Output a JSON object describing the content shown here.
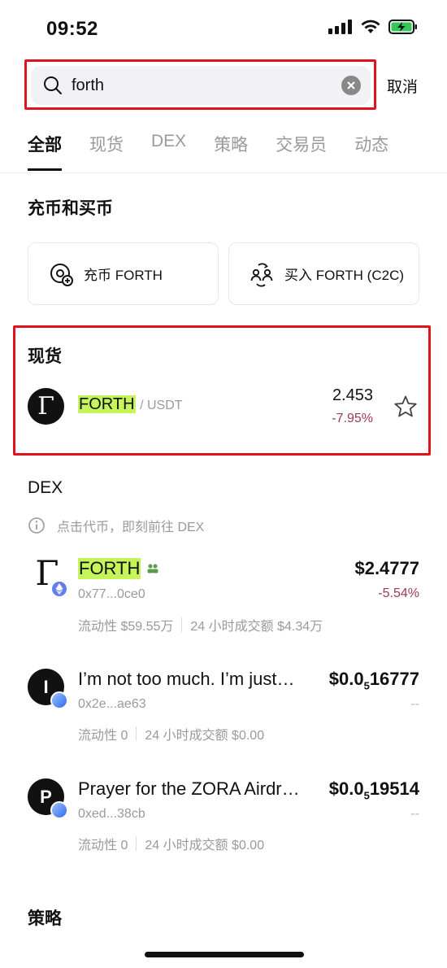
{
  "status_bar": {
    "time": "09:52"
  },
  "search": {
    "value": "forth",
    "cancel_label": "取消"
  },
  "tabs": [
    {
      "label": "全部",
      "active": true
    },
    {
      "label": "现货",
      "active": false
    },
    {
      "label": "DEX",
      "active": false
    },
    {
      "label": "策略",
      "active": false
    },
    {
      "label": "交易员",
      "active": false
    },
    {
      "label": "动态",
      "active": false
    }
  ],
  "deposit_section": {
    "title": "充币和买币",
    "deposit_label": "充币 FORTH",
    "buy_label": "买入 FORTH (C2C)"
  },
  "spot_section": {
    "title": "现货",
    "pair": {
      "base": "FORTH",
      "quote": "/ USDT",
      "price": "2.453",
      "change": "-7.95%",
      "avatar_letter": "Γ"
    }
  },
  "dex_section": {
    "title": "DEX",
    "hint": "点击代币，即刻前往 DEX",
    "tokens": [
      {
        "name": "FORTH",
        "address": "0x77...0ce0",
        "price": "$2.4777",
        "change": "-5.54%",
        "liquidity": "流动性 $59.55万",
        "volume": "24 小时成交额 $4.34万",
        "avatar_letter": "Γ"
      },
      {
        "name": "I’m not too much. I’m just…",
        "address": "0x2e...ae63",
        "price_main": "$0.0",
        "price_sub": "5",
        "price_rest": "16777",
        "change": "--",
        "liquidity": "流动性 0",
        "volume": "24 小时成交额 $0.00",
        "avatar_letter": "I"
      },
      {
        "name": "Prayer for the ZORA Airdr…",
        "address": "0xed...38cb",
        "price_main": "$0.0",
        "price_sub": "5",
        "price_rest": "19514",
        "change": "--",
        "liquidity": "流动性 0",
        "volume": "24 小时成交额 $0.00",
        "avatar_letter": "P"
      }
    ]
  },
  "strategy_section": {
    "title": "策略"
  },
  "colors": {
    "highlight": "#c6f55b",
    "negative": "#9a3a55",
    "annotation": "#e0141e"
  }
}
